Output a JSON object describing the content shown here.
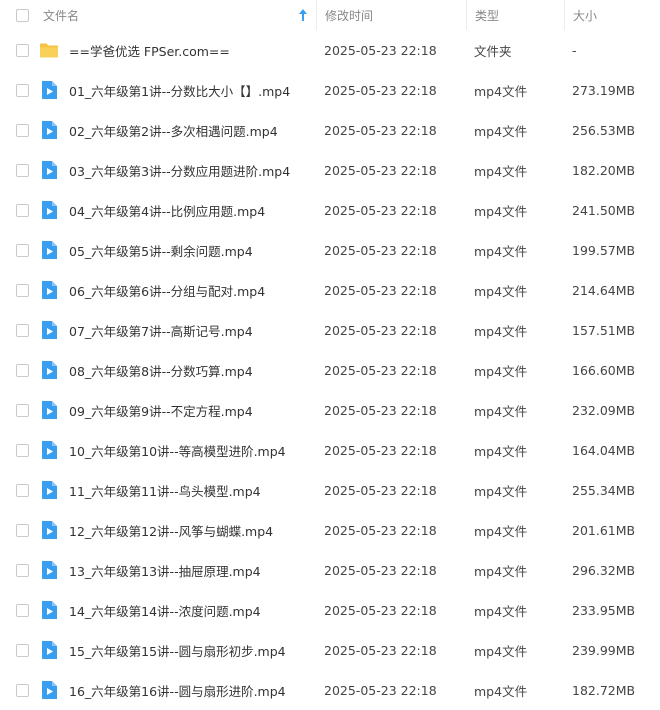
{
  "header": {
    "name": "文件名",
    "time": "修改时间",
    "type": "类型",
    "size": "大小"
  },
  "colors": {
    "folder": "#f6c343",
    "video": "#3a9ef0"
  },
  "files": [
    {
      "kind": "folder",
      "icon": "folder-icon",
      "name": "==学爸优选 FPSer.com==",
      "time": "2025-05-23 22:18",
      "type": "文件夹",
      "size": "-"
    },
    {
      "kind": "video",
      "icon": "video-file-icon",
      "name": "01_六年级第1讲--分数比大小【】.mp4",
      "time": "2025-05-23 22:18",
      "type": "mp4文件",
      "size": "273.19MB"
    },
    {
      "kind": "video",
      "icon": "video-file-icon",
      "name": "02_六年级第2讲--多次相遇问题.mp4",
      "time": "2025-05-23 22:18",
      "type": "mp4文件",
      "size": "256.53MB"
    },
    {
      "kind": "video",
      "icon": "video-file-icon",
      "name": "03_六年级第3讲--分数应用题进阶.mp4",
      "time": "2025-05-23 22:18",
      "type": "mp4文件",
      "size": "182.20MB"
    },
    {
      "kind": "video",
      "icon": "video-file-icon",
      "name": "04_六年级第4讲--比例应用题.mp4",
      "time": "2025-05-23 22:18",
      "type": "mp4文件",
      "size": "241.50MB"
    },
    {
      "kind": "video",
      "icon": "video-file-icon",
      "name": "05_六年级第5讲--剩余问题.mp4",
      "time": "2025-05-23 22:18",
      "type": "mp4文件",
      "size": "199.57MB"
    },
    {
      "kind": "video",
      "icon": "video-file-icon",
      "name": "06_六年级第6讲--分组与配对.mp4",
      "time": "2025-05-23 22:18",
      "type": "mp4文件",
      "size": "214.64MB"
    },
    {
      "kind": "video",
      "icon": "video-file-icon",
      "name": "07_六年级第7讲--高斯记号.mp4",
      "time": "2025-05-23 22:18",
      "type": "mp4文件",
      "size": "157.51MB"
    },
    {
      "kind": "video",
      "icon": "video-file-icon",
      "name": "08_六年级第8讲--分数巧算.mp4",
      "time": "2025-05-23 22:18",
      "type": "mp4文件",
      "size": "166.60MB"
    },
    {
      "kind": "video",
      "icon": "video-file-icon",
      "name": "09_六年级第9讲--不定方程.mp4",
      "time": "2025-05-23 22:18",
      "type": "mp4文件",
      "size": "232.09MB"
    },
    {
      "kind": "video",
      "icon": "video-file-icon",
      "name": "10_六年级第10讲--等高模型进阶.mp4",
      "time": "2025-05-23 22:18",
      "type": "mp4文件",
      "size": "164.04MB"
    },
    {
      "kind": "video",
      "icon": "video-file-icon",
      "name": "11_六年级第11讲--鸟头模型.mp4",
      "time": "2025-05-23 22:18",
      "type": "mp4文件",
      "size": "255.34MB"
    },
    {
      "kind": "video",
      "icon": "video-file-icon",
      "name": "12_六年级第12讲--风筝与蝴蝶.mp4",
      "time": "2025-05-23 22:18",
      "type": "mp4文件",
      "size": "201.61MB"
    },
    {
      "kind": "video",
      "icon": "video-file-icon",
      "name": "13_六年级第13讲--抽屉原理.mp4",
      "time": "2025-05-23 22:18",
      "type": "mp4文件",
      "size": "296.32MB"
    },
    {
      "kind": "video",
      "icon": "video-file-icon",
      "name": "14_六年级第14讲--浓度问题.mp4",
      "time": "2025-05-23 22:18",
      "type": "mp4文件",
      "size": "233.95MB"
    },
    {
      "kind": "video",
      "icon": "video-file-icon",
      "name": "15_六年级第15讲--圆与扇形初步.mp4",
      "time": "2025-05-23 22:18",
      "type": "mp4文件",
      "size": "239.99MB"
    },
    {
      "kind": "video",
      "icon": "video-file-icon",
      "name": "16_六年级第16讲--圆与扇形进阶.mp4",
      "time": "2025-05-23 22:18",
      "type": "mp4文件",
      "size": "182.72MB"
    }
  ]
}
